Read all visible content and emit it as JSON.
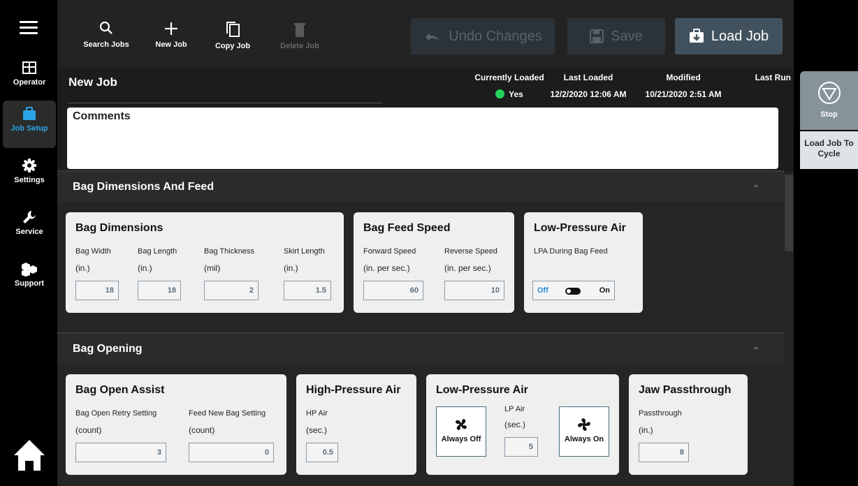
{
  "nav": {
    "items": [
      {
        "label": "Operator",
        "icon": "grid-icon"
      },
      {
        "label": "Job Setup",
        "icon": "briefcase-icon",
        "active": true
      },
      {
        "label": "Settings",
        "icon": "gear-icon"
      },
      {
        "label": "Service",
        "icon": "wrench-icon"
      },
      {
        "label": "Support",
        "icon": "support-icon"
      }
    ]
  },
  "toolbar": {
    "search_jobs": "Search Jobs",
    "new_job": "New Job",
    "copy_job": "Copy Job",
    "delete_job": "Delete Job",
    "undo_changes": "Undo Changes",
    "save": "Save",
    "load_job": "Load Job"
  },
  "job": {
    "name": "New Job",
    "currently_loaded_label": "Currently Loaded",
    "currently_loaded_value": "Yes",
    "last_loaded_label": "Last Loaded",
    "last_loaded_value": "12/2/2020 12:06 AM",
    "modified_label": "Modified",
    "modified_value": "10/21/2020 2:51 AM",
    "last_run_label": "Last Run",
    "comments_label": "Comments"
  },
  "right_panel": {
    "stop": "Stop",
    "load_job_to_cycle_line1": "Load Job To",
    "load_job_to_cycle_line2": "Cycle"
  },
  "sections": {
    "bag_dimensions_feed": {
      "title": "Bag Dimensions And Feed",
      "bag_dimensions": {
        "title": "Bag Dimensions",
        "fields": [
          {
            "label": "Bag Width",
            "unit": "(in.)",
            "value": "18"
          },
          {
            "label": "Bag Length",
            "unit": "(in.)",
            "value": "18"
          },
          {
            "label": "Bag Thickness",
            "unit": "(mil)",
            "value": "2"
          },
          {
            "label": "Skirt Length",
            "unit": "(in.)",
            "value": "1.5"
          }
        ]
      },
      "bag_feed_speed": {
        "title": "Bag Feed Speed",
        "fields": [
          {
            "label": "Forward Speed",
            "unit": "(in. per sec.)",
            "value": "60"
          },
          {
            "label": "Reverse Speed",
            "unit": "(in. per sec.)",
            "value": "10"
          }
        ]
      },
      "low_pressure_air": {
        "title": "Low-Pressure Air",
        "label": "LPA During Bag Feed",
        "off": "Off",
        "on": "On"
      }
    },
    "bag_opening": {
      "title": "Bag Opening",
      "bag_open_assist": {
        "title": "Bag Open Assist",
        "fields": [
          {
            "label": "Bag Open Retry Setting",
            "unit": "(count)",
            "value": "3"
          },
          {
            "label": "Feed New Bag Setting",
            "unit": "(count)",
            "value": "0"
          }
        ]
      },
      "high_pressure_air": {
        "title": "High-Pressure Air",
        "label": "HP Air",
        "unit": "(sec.)",
        "value": "0.5"
      },
      "low_pressure_air": {
        "title": "Low-Pressure Air",
        "always_off": "Always Off",
        "label": "LP Air",
        "unit": "(sec.)",
        "value": "5",
        "always_on": "Always On"
      },
      "jaw_passthrough": {
        "title": "Jaw Passthrough",
        "label": "Passthrough",
        "unit": "(in.)",
        "value": "8"
      }
    }
  },
  "colors": {
    "accent_blue": "#2aa4e6",
    "loaded_green": "#26d15d",
    "load_button": "#41525e"
  }
}
